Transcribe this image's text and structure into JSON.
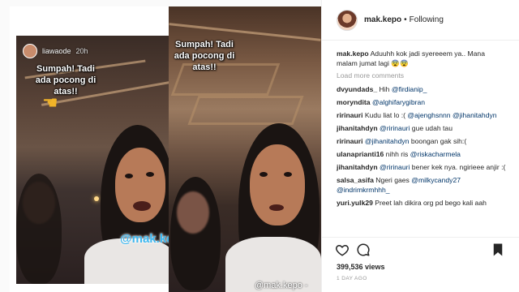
{
  "story": {
    "username": "liawaode",
    "time": "20h",
    "caption_left": "Sumpah! Tadi ada pocong di atas!!",
    "caption_right": "Sumpah! Tadi ada pocong di atas!!",
    "watermark": "@mak.kepo",
    "watermark_small": "@mak.kepo -"
  },
  "post": {
    "username": "mak.kepo",
    "separator": "•",
    "follow_status": "Following",
    "caption_user": "mak.kepo",
    "caption_text": "Aduuhh kok jadi syereeem ya.. Mana malam jumat lagi 😨😨",
    "load_more": "Load more comments",
    "comments": [
      {
        "user": "dvyundads_",
        "text": "Hih ",
        "mention": "@firdianip_"
      },
      {
        "user": "moryndita",
        "text": "",
        "mention": "@alghifarygibran"
      },
      {
        "user": "ririnauri",
        "text": "Kudu liat lo :( ",
        "mention": "@ajenghsnnn @jihanitahdyn"
      },
      {
        "user": "jihanitahdyn",
        "text": "",
        "mention": "@ririnauri",
        "after": " gue udah tau"
      },
      {
        "user": "ririnauri",
        "text": "",
        "mention": "@jihanitahdyn",
        "after": " boongan gak sih:("
      },
      {
        "user": "ulanaprianti16",
        "text": "nihh ris ",
        "mention": "@riskacharmela"
      },
      {
        "user": "jihanitahdyn",
        "text": "",
        "mention": "@ririnauri",
        "after": " bener kek nya. ngirieee anjir :("
      },
      {
        "user": "salsa_asifa",
        "text": "Ngeri gaes ",
        "mention": "@milkycandy27 @indrimkrmhhh_"
      },
      {
        "user": "yuri.yulk29",
        "text": "Preet lah dikira org pd bego kali aah",
        "mention": ""
      }
    ],
    "views": "399,536 views",
    "posted": "1 DAY AGO"
  },
  "icons": {
    "like": "heart-icon",
    "comment": "comment-icon",
    "save": "bookmark-icon"
  },
  "colors": {
    "watermark": "#3fb8f0",
    "mention": "#003569",
    "pointer": "#f2b428"
  }
}
